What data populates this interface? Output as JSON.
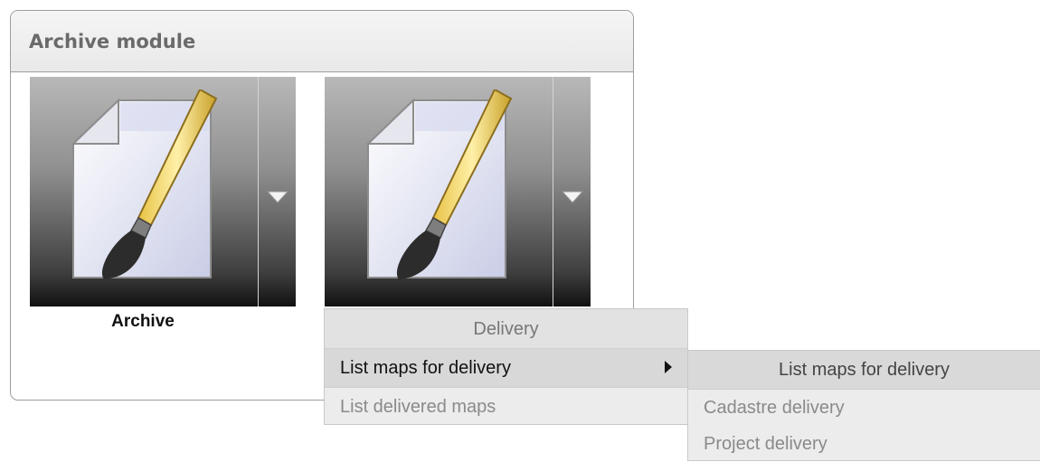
{
  "panel": {
    "title": "Archive module"
  },
  "tiles": [
    {
      "label": "Archive",
      "icon": "document-paintbrush-icon"
    },
    {
      "label": "",
      "icon": "document-paintbrush-icon"
    }
  ],
  "menu": {
    "header": "Delivery",
    "items": [
      {
        "label": "List maps for delivery",
        "has_submenu": true
      },
      {
        "label": "List delivered maps"
      }
    ]
  },
  "submenu": {
    "header": "List maps for delivery",
    "items": [
      {
        "label": "Cadastre delivery"
      },
      {
        "label": "Project delivery"
      }
    ]
  },
  "colors": {
    "panel_border": "#9d9d9d",
    "menu_bg": "#ececec",
    "menu_active": "#d8d8d8"
  }
}
